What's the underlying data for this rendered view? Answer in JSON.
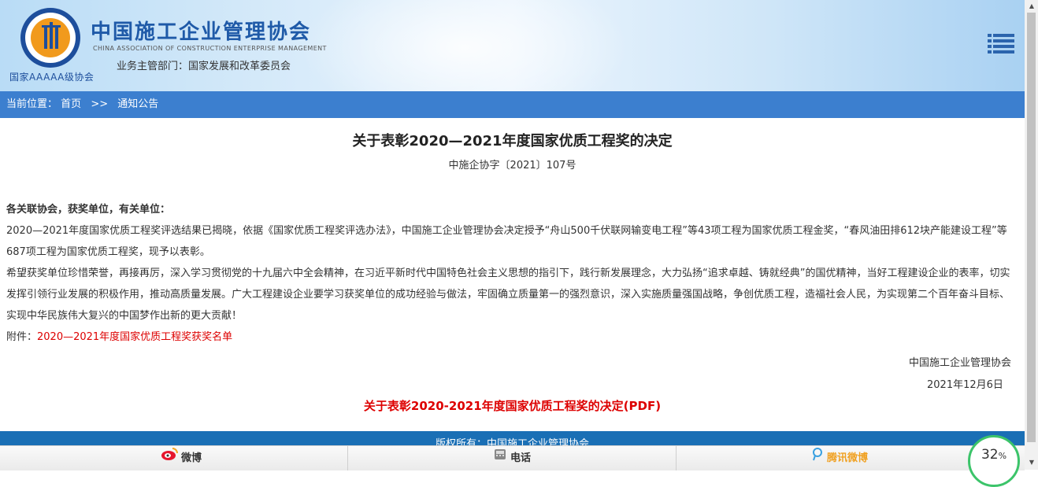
{
  "header": {
    "org_name_cn": "中国施工企业管理协会",
    "org_name_en": "CHINA ASSOCIATION OF CONSTRUCTION ENTERPRISE MANAGEMENT",
    "supervisor": "业务主管部门：国家发展和改革委员会",
    "grade": "国家AAAAA级协会"
  },
  "breadcrumb": {
    "label": "当前位置：",
    "home": "首页",
    "separator": ">>",
    "current": "通知公告"
  },
  "article": {
    "title": "关于表彰2020—2021年度国家优质工程奖的决定",
    "doc_number": "中施企协字〔2021〕107号",
    "salutation": "各关联协会，获奖单位，有关单位：",
    "paragraph1": "2020—2021年度国家优质工程奖评选结果已揭晓，依据《国家优质工程奖评选办法》，中国施工企业管理协会决定授予“舟山500千伏联网输变电工程”等43项工程为国家优质工程金奖，“春风油田排612块产能建设工程”等687项工程为国家优质工程奖，现予以表彰。",
    "paragraph2": "希望获奖单位珍惜荣誉，再接再厉，深入学习贯彻党的十九届六中全会精神，在习近平新时代中国特色社会主义思想的指引下，践行新发展理念，大力弘扬“追求卓越、铸就经典”的国优精神，当好工程建设企业的表率，切实发挥引领行业发展的积极作用，推动高质量发展。广大工程建设企业要学习获奖单位的成功经验与做法，牢固确立质量第一的强烈意识，深入实施质量强国战略，争创优质工程，造福社会人民，为实现第二个百年奋斗目标、实现中华民族伟大复兴的中国梦作出新的更大贡献！",
    "attachment_label": "附件：",
    "attachment_link": "2020—2021年度国家优质工程奖获奖名单",
    "signature_org": "中国施工企业管理协会",
    "signature_date": "2021年12月6日",
    "pdf_link": "关于表彰2020-2021年度国家优质工程奖的决定(PDF)"
  },
  "footer": {
    "copyright": "版权所有：中国施工企业管理协会"
  },
  "bottom_bar": {
    "weibo": "微博",
    "phone": "电话",
    "tencent_weibo": "腾讯微博"
  },
  "progress": {
    "value": "32",
    "unit": "%"
  },
  "colors": {
    "accent_blue": "#3c7fcf",
    "link_red": "#dd0000",
    "logo_orange": "#f19a1d"
  }
}
